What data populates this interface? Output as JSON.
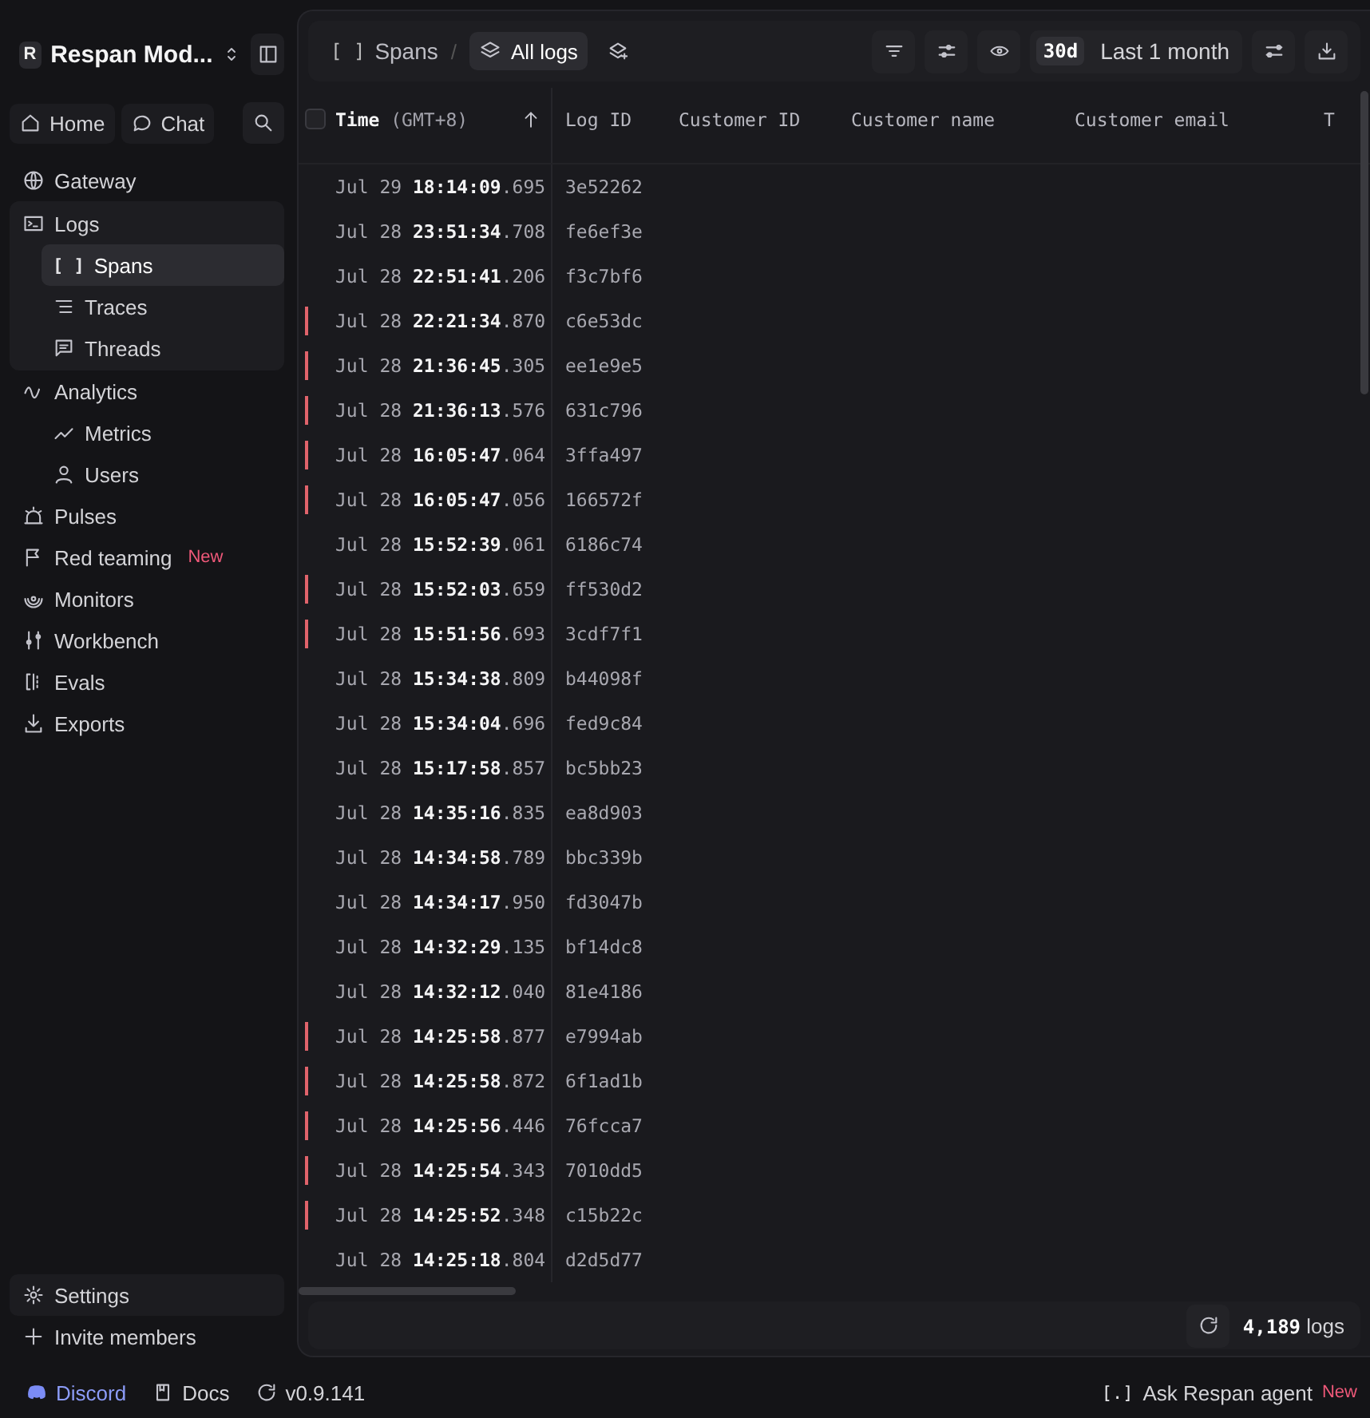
{
  "workspace": {
    "avatar": "R",
    "name": "Respan Mod..."
  },
  "quick_nav": [
    {
      "label": "Home"
    },
    {
      "label": "Chat"
    }
  ],
  "sidebar": {
    "items": [
      {
        "label": "Gateway",
        "selected": false
      },
      {
        "label": "Logs",
        "selected": false,
        "children": [
          {
            "glyph": "[ ]",
            "label": "Spans",
            "selected": true
          },
          {
            "label": "Traces",
            "selected": false
          },
          {
            "label": "Threads",
            "selected": false
          }
        ]
      },
      {
        "label": "Analytics",
        "selected": false,
        "children": [
          {
            "label": "Metrics",
            "selected": false
          },
          {
            "label": "Users",
            "selected": false
          }
        ]
      },
      {
        "label": "Pulses",
        "selected": false
      },
      {
        "label": "Red teaming",
        "badge": "New",
        "selected": false
      },
      {
        "label": "Monitors",
        "selected": false
      },
      {
        "label": "Workbench",
        "selected": false
      },
      {
        "label": "Evals",
        "selected": false
      },
      {
        "label": "Exports",
        "selected": false
      }
    ],
    "bottom": [
      {
        "label": "Settings"
      },
      {
        "label": "Invite members"
      }
    ]
  },
  "breadcrumb": {
    "glyph": "[ ]",
    "label": "Spans",
    "separator": "/",
    "view": {
      "label": "All logs",
      "selected": true
    }
  },
  "time_range": {
    "short": "30d",
    "label": "Last 1 month"
  },
  "table": {
    "select_all": {
      "checked": false
    },
    "columns": [
      {
        "label": "**Time** (GMT+8)"
      },
      {
        "label": "Log ID"
      },
      {
        "label": "Customer ID"
      },
      {
        "label": "Customer name"
      },
      {
        "label": "Customer email"
      },
      {
        "label": "T"
      }
    ],
    "rows": [
      {
        "time": "Jul 29 **18:14:09**.695",
        "log_id": "3e52262",
        "error": false
      },
      {
        "time": "Jul 28 **23:51:34**.708",
        "log_id": "fe6ef3e",
        "error": false
      },
      {
        "time": "Jul 28 **22:51:41**.206",
        "log_id": "f3c7bf6",
        "error": false
      },
      {
        "time": "Jul 28 **22:21:34**.870",
        "log_id": "c6e53dc",
        "error": true
      },
      {
        "time": "Jul 28 **21:36:45**.305",
        "log_id": "ee1e9e5",
        "error": true
      },
      {
        "time": "Jul 28 **21:36:13**.576",
        "log_id": "631c796",
        "error": true
      },
      {
        "time": "Jul 28 **16:05:47**.064",
        "log_id": "3ffa497",
        "error": true
      },
      {
        "time": "Jul 28 **16:05:47**.056",
        "log_id": "166572f",
        "error": true
      },
      {
        "time": "Jul 28 **15:52:39**.061",
        "log_id": "6186c74",
        "error": false
      },
      {
        "time": "Jul 28 **15:52:03**.659",
        "log_id": "ff530d2",
        "error": true
      },
      {
        "time": "Jul 28 **15:51:56**.693",
        "log_id": "3cdf7f1",
        "error": true
      },
      {
        "time": "Jul 28 **15:34:38**.809",
        "log_id": "b44098f",
        "error": false
      },
      {
        "time": "Jul 28 **15:34:04**.696",
        "log_id": "fed9c84",
        "error": false
      },
      {
        "time": "Jul 28 **15:17:58**.857",
        "log_id": "bc5bb23",
        "error": false
      },
      {
        "time": "Jul 28 **14:35:16**.835",
        "log_id": "ea8d903",
        "error": false
      },
      {
        "time": "Jul 28 **14:34:58**.789",
        "log_id": "bbc339b",
        "error": false
      },
      {
        "time": "Jul 28 **14:34:17**.950",
        "log_id": "fd3047b",
        "error": false
      },
      {
        "time": "Jul 28 **14:32:29**.135",
        "log_id": "bf14dc8",
        "error": false
      },
      {
        "time": "Jul 28 **14:32:12**.040",
        "log_id": "81e4186",
        "error": false
      },
      {
        "time": "Jul 28 **14:25:58**.877",
        "log_id": "e7994ab",
        "error": true
      },
      {
        "time": "Jul 28 **14:25:58**.872",
        "log_id": "6f1ad1b",
        "error": true
      },
      {
        "time": "Jul 28 **14:25:56**.446",
        "log_id": "76fcca7",
        "error": true
      },
      {
        "time": "Jul 28 **14:25:54**.343",
        "log_id": "7010dd5",
        "error": true
      },
      {
        "time": "Jul 28 **14:25:52**.348",
        "log_id": "c15b22c",
        "error": true
      },
      {
        "time": "Jul 28 **14:25:18**.804",
        "log_id": "d2d5d77",
        "error": false
      }
    ]
  },
  "footer": {
    "count": "**4,189** logs"
  },
  "bottom_bar": {
    "links": [
      {
        "label": "Discord"
      },
      {
        "label": "Docs"
      },
      {
        "label": "v0.9.141"
      }
    ],
    "agent": {
      "glyph": "[.]",
      "label": "Ask Respan agent",
      "badge": "New"
    }
  }
}
